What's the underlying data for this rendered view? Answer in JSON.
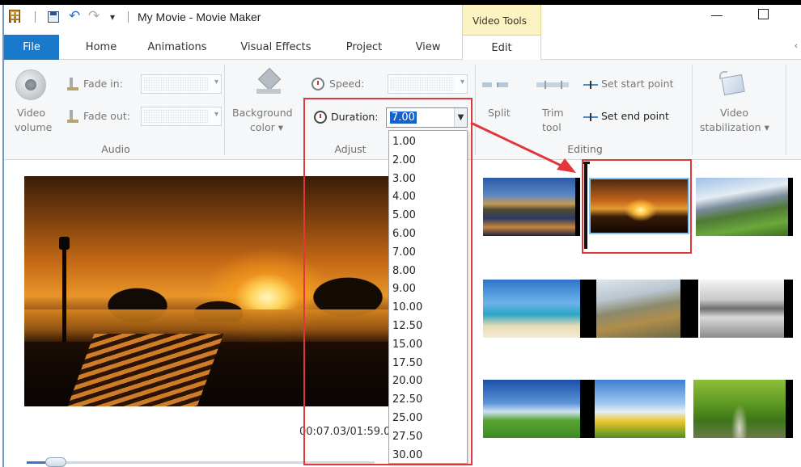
{
  "titlebar": {
    "title": "My Movie - Movie Maker",
    "contextual_tab_group": "Video Tools"
  },
  "tabs": [
    "File",
    "Home",
    "Animations",
    "Visual Effects",
    "Project",
    "View",
    "Edit"
  ],
  "ribbon": {
    "audio": {
      "group_label": "Audio",
      "video_volume_label_line1": "Video",
      "video_volume_label_line2": "volume",
      "fade_in_label": "Fade in:",
      "fade_out_label": "Fade out:"
    },
    "adjust": {
      "group_label": "Adjust",
      "background_color_line1": "Background",
      "background_color_line2": "color",
      "speed_label": "Speed:",
      "duration_label": "Duration:",
      "duration_value": "7.00"
    },
    "editing": {
      "group_label": "Editing",
      "split_label": "Split",
      "trim_tool_line1": "Trim",
      "trim_tool_line2": "tool",
      "set_start_point": "Set start point",
      "set_end_point": "Set end point"
    },
    "stabilization": {
      "label_line1": "Video",
      "label_line2": "stabilization"
    }
  },
  "duration_options": [
    "1.00",
    "2.00",
    "3.00",
    "4.00",
    "5.00",
    "6.00",
    "7.00",
    "8.00",
    "9.00",
    "10.00",
    "12.50",
    "15.00",
    "17.50",
    "20.00",
    "22.50",
    "25.00",
    "27.50",
    "30.00"
  ],
  "preview": {
    "time_readout": "00:07.03/01:59.0",
    "seek_progress": 0.1
  },
  "storyboard": {
    "selected_clip": "sunset-bench-clip"
  },
  "colors": {
    "file_tab": "#1979ca",
    "contextual_tab": "#fbf4c2",
    "annotation_red": "#e2373a",
    "selection": "#1662c9"
  },
  "icons": [
    "app-icon",
    "save-icon",
    "undo-icon",
    "redo-icon",
    "customize-dropdown-icon",
    "minimize-icon",
    "maximize-icon",
    "speaker-icon",
    "fade-in-icon",
    "fade-out-icon",
    "bucket-icon",
    "speed-stopwatch-icon",
    "duration-stopwatch-icon",
    "split-icon",
    "trim-icon",
    "set-start-icon",
    "set-end-icon",
    "stabilization-icon"
  ]
}
